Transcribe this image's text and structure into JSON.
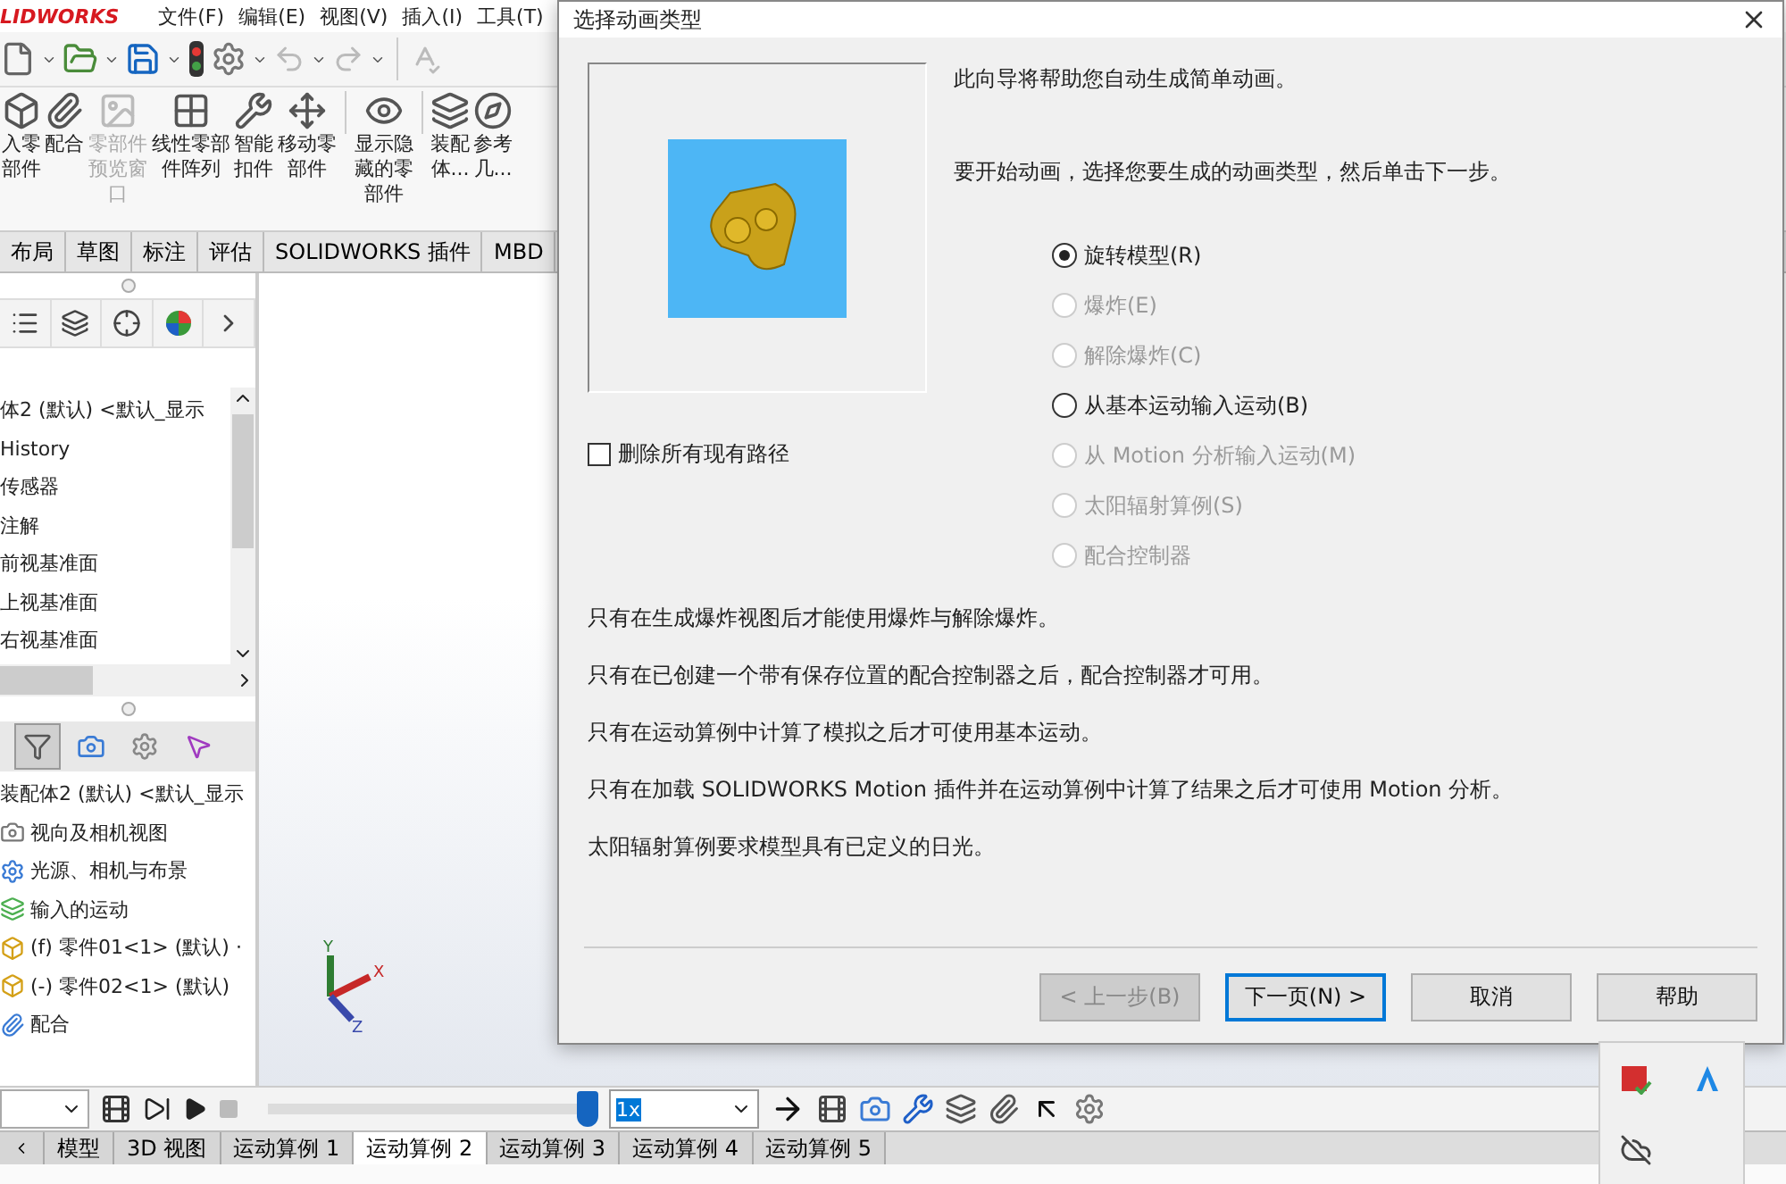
{
  "app": {
    "logo": "LIDWORKS",
    "menu": [
      "文件(F)",
      "编辑(E)",
      "视图(V)",
      "插入(I)",
      "工具(T)"
    ]
  },
  "ribbon": [
    {
      "label": "入零部件",
      "disabled": false
    },
    {
      "label": "配合",
      "disabled": false
    },
    {
      "label": "零部件预览窗口",
      "disabled": true
    },
    {
      "label": "线性零部件阵列",
      "disabled": false
    },
    {
      "label": "智能扣件",
      "disabled": false
    },
    {
      "label": "移动零部件",
      "disabled": false
    },
    {
      "label": "显示隐藏的零部件",
      "disabled": false
    },
    {
      "label": "装配体...",
      "disabled": false
    },
    {
      "label": "参考几...",
      "disabled": false
    }
  ],
  "command_tabs": [
    "布局",
    "草图",
    "标注",
    "评估",
    "SOLIDWORKS 插件",
    "MBD"
  ],
  "feature_tree": {
    "header": "体2 (默认) <默认_显示",
    "items": [
      "History",
      "传感器",
      "注解",
      "前视基准面",
      "上视基准面",
      "右视基准面"
    ]
  },
  "motion_tree": {
    "header": "装配体2 (默认) <默认_显示",
    "items": [
      {
        "label": "视向及相机视图",
        "kind": "camera"
      },
      {
        "label": "光源、相机与布景",
        "kind": "scene"
      },
      {
        "label": "输入的运动",
        "kind": "motion"
      },
      {
        "label": "(f) 零件01<1> (默认) ·",
        "kind": "part"
      },
      {
        "label": "(-) 零件02<1> (默认)",
        "kind": "part"
      },
      {
        "label": "配合",
        "kind": "mate"
      }
    ]
  },
  "graphics": {
    "axes": [
      "X",
      "Y",
      "Z"
    ]
  },
  "motion_toolbar": {
    "level": 1,
    "speed": "1x"
  },
  "study_tabs": [
    {
      "label": "模型",
      "selected": false
    },
    {
      "label": "3D 视图",
      "selected": false
    },
    {
      "label": "运动算例 1",
      "selected": false
    },
    {
      "label": "运动算例 2",
      "selected": true
    },
    {
      "label": "运动算例 3",
      "selected": false
    },
    {
      "label": "运动算例 4",
      "selected": false
    },
    {
      "label": "运动算例 5",
      "selected": false
    }
  ],
  "dialog": {
    "title": "选择动画类型",
    "intro": [
      "此向导将帮助您自动生成简单动画。",
      "要开始动画，选择您要生成的动画类型，然后单击下一步。"
    ],
    "delete_paths": {
      "label": "删除所有现有路径",
      "checked": false
    },
    "options": [
      {
        "label": "旋转模型(R)",
        "selected": true,
        "disabled": false
      },
      {
        "label": "爆炸(E)",
        "selected": false,
        "disabled": true
      },
      {
        "label": "解除爆炸(C)",
        "selected": false,
        "disabled": true
      },
      {
        "label": "从基本运动输入运动(B)",
        "selected": false,
        "disabled": false
      },
      {
        "label": "从 Motion 分析输入运动(M)",
        "selected": false,
        "disabled": true
      },
      {
        "label": "太阳辐射算例(S)",
        "selected": false,
        "disabled": true
      },
      {
        "label": "配合控制器",
        "selected": false,
        "disabled": true
      }
    ],
    "notes": [
      "只有在生成爆炸视图后才能使用爆炸与解除爆炸。",
      "只有在已创建一个带有保存位置的配合控制器之后，配合控制器才可用。",
      "只有在运动算例中计算了模拟之后才可使用基本运动。",
      "只有在加载 SOLIDWORKS Motion 插件并在运动算例中计算了结果之后才可使用 Motion 分析。",
      "太阳辐射算例要求模型具有已定义的日光。"
    ],
    "buttons": [
      {
        "label": "< 上一步(B)",
        "disabled": true,
        "default": false
      },
      {
        "label": "下一页(N) >",
        "disabled": false,
        "default": true
      },
      {
        "label": "取消",
        "disabled": false,
        "default": false
      },
      {
        "label": "帮助",
        "disabled": false,
        "default": false
      }
    ]
  }
}
